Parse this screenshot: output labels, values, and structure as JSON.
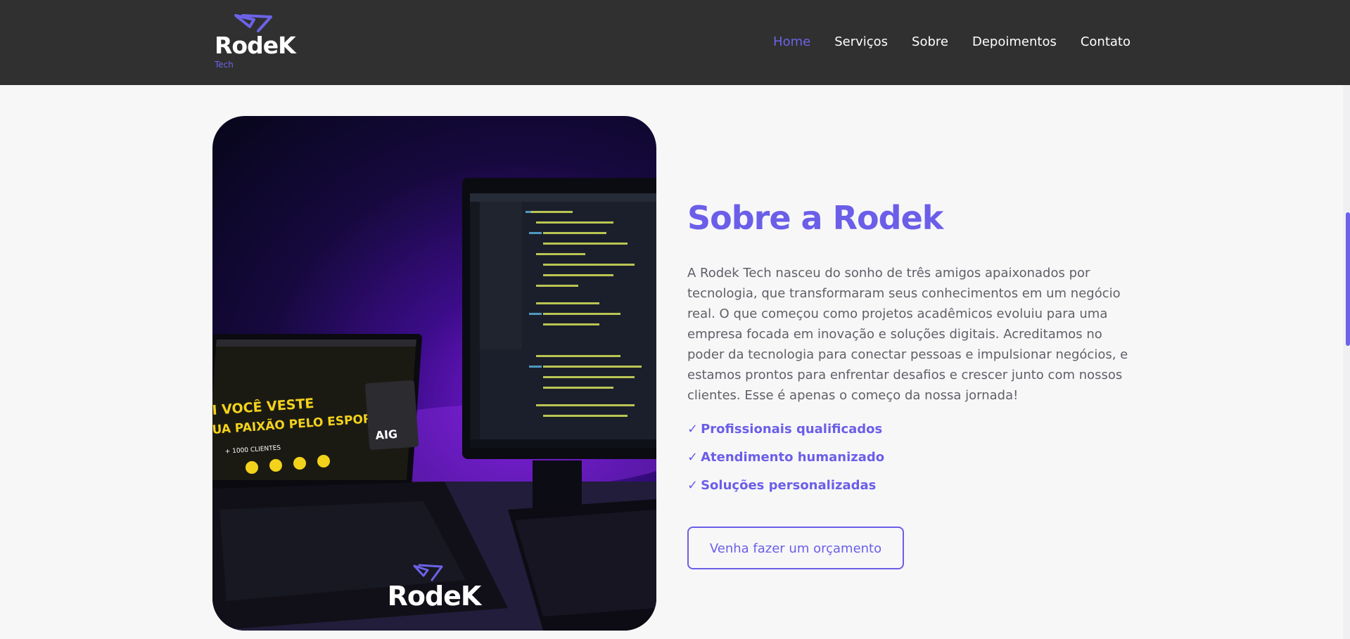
{
  "brand": {
    "name": "RodeK",
    "tagline": "Tech",
    "accent_color": "#6b5ee8",
    "header_bg": "#303030"
  },
  "nav": {
    "items": [
      {
        "label": "Home",
        "active": true
      },
      {
        "label": "Serviços",
        "active": false
      },
      {
        "label": "Sobre",
        "active": false
      },
      {
        "label": "Depoimentos",
        "active": false
      },
      {
        "label": "Contato",
        "active": false
      }
    ]
  },
  "about": {
    "title": "Sobre a Rodek",
    "description": "A Rodek Tech nasceu do sonho de três amigos apaixonados por tecnologia, que transformaram seus conhecimentos em um negócio real. O que começou como projetos acadêmicos evoluiu para uma empresa focada em inovação e soluções digitais. Acreditamos no poder da tecnologia para conectar pessoas e impulsionar negócios, e estamos prontos para enfrentar desafios e crescer junto com nossos clientes. Esse é apenas o começo da nossa jornada!",
    "features": [
      {
        "check": "✓",
        "label": "Profissionais qualificados"
      },
      {
        "check": "✓",
        "label": "Atendimento humanizado"
      },
      {
        "check": "✓",
        "label": "Soluções personalizadas"
      }
    ],
    "cta_label": "Venha fazer um orçamento"
  },
  "photo": {
    "icon": "laptop-and-monitor-icon",
    "laptop_screen": {
      "line1": "I VOCÊ VESTE",
      "line2": "UA PAIXÃO PELO ESPORTE.",
      "clients": "+ 1000 CLIENTES",
      "badge": "AIG"
    },
    "watermark": "RodeK"
  }
}
